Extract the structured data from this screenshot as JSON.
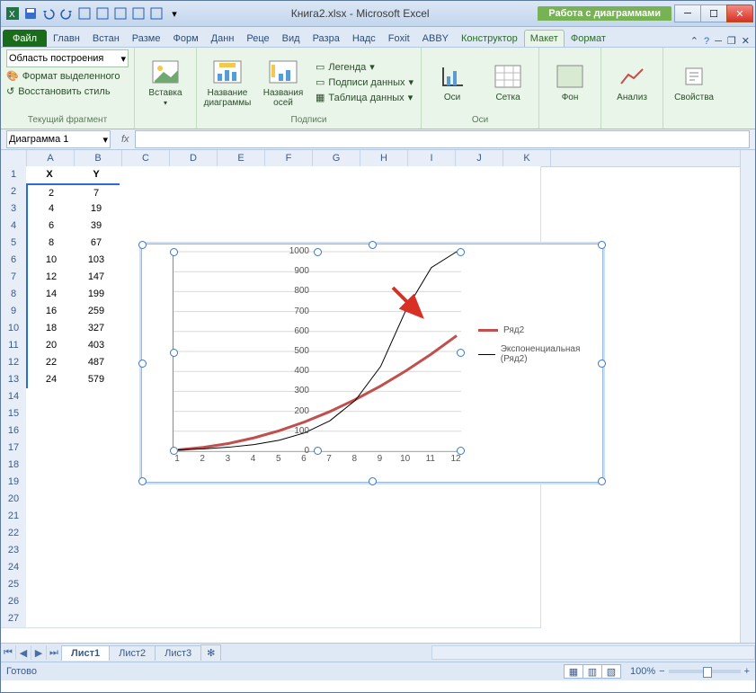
{
  "window": {
    "title_doc": "Книга2.xlsx",
    "title_app": "Microsoft Excel",
    "chart_tools": "Работа с диаграммами"
  },
  "tabs": {
    "file": "Файл",
    "list": [
      "Главн",
      "Встан",
      "Разме",
      "Форм",
      "Данн",
      "Реце",
      "Вид",
      "Разра",
      "Надс",
      "Foxit",
      "ABBY"
    ],
    "chart": [
      "Конструктор",
      "Макет",
      "Формат"
    ],
    "active": "Макет"
  },
  "ribbon": {
    "combo": "Область построения",
    "fmt_sel": "Формат выделенного",
    "reset": "Восстановить стиль",
    "grp_cursel": "Текущий фрагмент",
    "insert": "Вставка",
    "chart_title": "Название диаграммы",
    "axis_titles": "Названия осей",
    "legend": "Легенда",
    "data_labels": "Подписи данных",
    "data_table": "Таблица данных",
    "grp_labels": "Подписи",
    "axes": "Оси",
    "gridlines": "Сетка",
    "grp_axes": "Оси",
    "bg": "Фон",
    "analysis": "Анализ",
    "props": "Свойства"
  },
  "namebox": "Диаграмма 1",
  "fx": "fx",
  "columns": [
    "A",
    "B",
    "C",
    "D",
    "E",
    "F",
    "G",
    "H",
    "I",
    "J",
    "K"
  ],
  "table": {
    "headers": [
      "X",
      "Y"
    ],
    "rows": [
      [
        2,
        7
      ],
      [
        4,
        19
      ],
      [
        6,
        39
      ],
      [
        8,
        67
      ],
      [
        10,
        103
      ],
      [
        12,
        147
      ],
      [
        14,
        199
      ],
      [
        16,
        259
      ],
      [
        18,
        327
      ],
      [
        20,
        403
      ],
      [
        22,
        487
      ],
      [
        24,
        579
      ]
    ]
  },
  "sheets": {
    "active": "Лист1",
    "others": [
      "Лист2",
      "Лист3"
    ]
  },
  "status": {
    "ready": "Готово",
    "zoom": "100%"
  },
  "legend": {
    "s1": "Ряд2",
    "s2": "Экспоненциальная (Ряд2)"
  },
  "chart_data": {
    "type": "line",
    "x": [
      1,
      2,
      3,
      4,
      5,
      6,
      7,
      8,
      9,
      10,
      11,
      12
    ],
    "series": [
      {
        "name": "Ряд2",
        "values": [
          7,
          19,
          39,
          67,
          103,
          147,
          199,
          259,
          327,
          403,
          487,
          579
        ],
        "color": "#c0504d",
        "weight": 3
      },
      {
        "name": "Экспоненциальная (Ряд2)",
        "values": [
          7,
          12,
          20,
          33,
          55,
          92,
          153,
          255,
          425,
          708,
          920,
          1000
        ],
        "color": "#000000",
        "weight": 1
      }
    ],
    "xlabel": "",
    "ylabel": "",
    "xlim": [
      1,
      12
    ],
    "ylim": [
      0,
      1000
    ],
    "yticks": [
      0,
      100,
      200,
      300,
      400,
      500,
      600,
      700,
      800,
      900,
      1000
    ],
    "xticks": [
      1,
      2,
      3,
      4,
      5,
      6,
      7,
      8,
      9,
      10,
      11,
      12
    ]
  }
}
